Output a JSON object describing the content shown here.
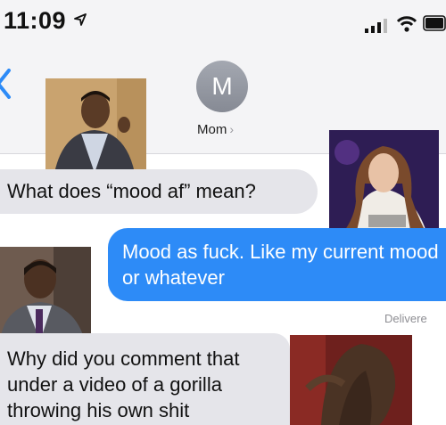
{
  "status_bar": {
    "time": "11:09"
  },
  "header": {
    "avatar_initial": "M",
    "contact_name": "Mom",
    "contact_chevron": "›"
  },
  "messages": [
    {
      "direction": "received",
      "text": "What does “mood af” mean?"
    },
    {
      "direction": "sent",
      "text": "Mood as fuck. Like my current mood or whatever"
    },
    {
      "direction": "received",
      "text": "Why did you comment that under a video of a gorilla throwing his own shit"
    }
  ],
  "delivered_label": "Delivere",
  "colors": {
    "sent_bubble": "#2d8bf7",
    "received_bubble": "#e5e5ea",
    "header_bg": "#f4f4f6"
  },
  "icons": [
    "location-arrow-icon",
    "signal-icon",
    "wifi-icon",
    "battery-icon",
    "back-chevron-icon"
  ],
  "reaction_photos": [
    "man-in-vest-smoking-photo",
    "woman-with-wavy-hair-photo",
    "bald-man-in-vest-photo",
    "woman-hair-flip-photo"
  ]
}
